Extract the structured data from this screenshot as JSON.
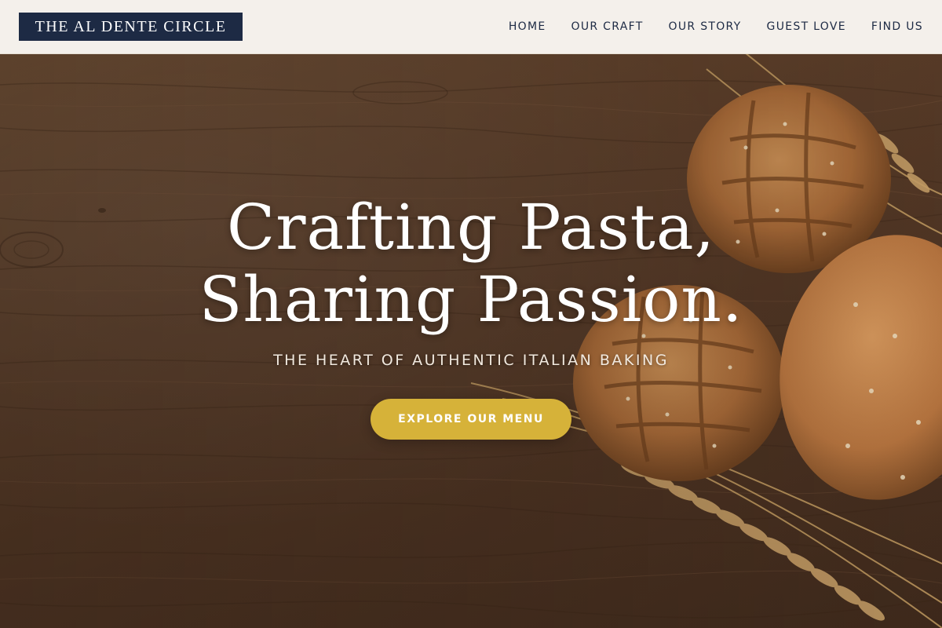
{
  "brand": {
    "name": "THE AL DENTE CIRCLE"
  },
  "nav": {
    "items": [
      {
        "label": "HOME"
      },
      {
        "label": "OUR CRAFT"
      },
      {
        "label": "OUR STORY"
      },
      {
        "label": "GUEST LOVE"
      },
      {
        "label": "FIND US"
      }
    ]
  },
  "hero": {
    "headline_line1": "Crafting Pasta,",
    "headline_line2": "Sharing Passion.",
    "tagline": "THE HEART OF AUTHENTIC ITALIAN BAKING",
    "cta_label": "EXPLORE OUR MENU"
  },
  "colors": {
    "navy": "#1d2a44",
    "gold": "#d6b239",
    "wood": "#5a3d29",
    "cream": "#faf7f2"
  },
  "icons": {
    "hero_image": "bread-loaves-and-wheat-image"
  }
}
